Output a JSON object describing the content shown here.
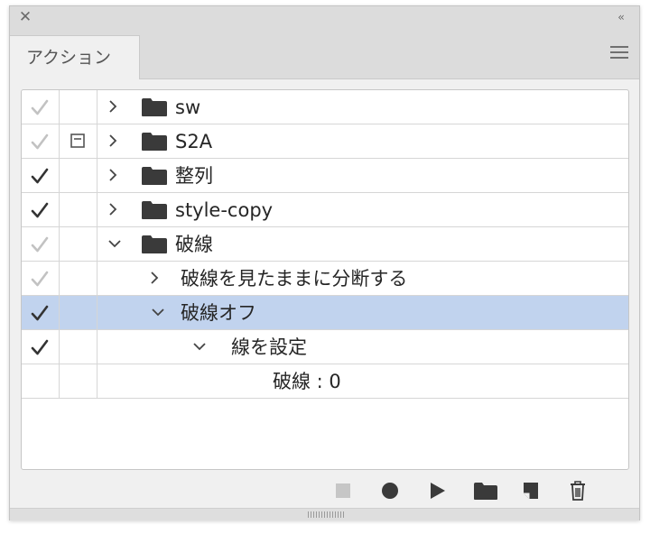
{
  "panel": {
    "tab_label": "アクション"
  },
  "colors": {
    "selected_row": "#c1d3ee",
    "check_active": "#333333",
    "check_inactive": "#c2c2c2"
  },
  "actions": [
    {
      "label": "sw",
      "checked": true,
      "check_state": "inactive",
      "dialog": false,
      "expanded": false,
      "type": "set"
    },
    {
      "label": "S2A",
      "checked": true,
      "check_state": "inactive",
      "dialog": true,
      "expanded": false,
      "type": "set"
    },
    {
      "label": "整列",
      "checked": true,
      "check_state": "active",
      "dialog": false,
      "expanded": false,
      "type": "set"
    },
    {
      "label": "style-copy",
      "checked": true,
      "check_state": "active",
      "dialog": false,
      "expanded": false,
      "type": "set"
    },
    {
      "label": "破線",
      "checked": true,
      "check_state": "inactive",
      "dialog": false,
      "expanded": true,
      "type": "set"
    },
    {
      "label": "破線を見たままに分断する",
      "checked": true,
      "check_state": "inactive",
      "dialog": false,
      "expanded": false,
      "type": "action"
    },
    {
      "label": "破線オフ",
      "checked": true,
      "check_state": "active",
      "dialog": false,
      "expanded": true,
      "type": "action",
      "selected": true
    },
    {
      "label": "線を設定",
      "checked": true,
      "check_state": "active",
      "dialog": false,
      "expanded": true,
      "type": "command"
    },
    {
      "label": "破線 : 0",
      "checked": false,
      "dialog": false,
      "type": "parameter"
    }
  ],
  "toolbar": {
    "buttons": [
      "stop-icon",
      "record-icon",
      "play-icon",
      "folder-icon",
      "new-action-icon",
      "trash-icon"
    ]
  }
}
